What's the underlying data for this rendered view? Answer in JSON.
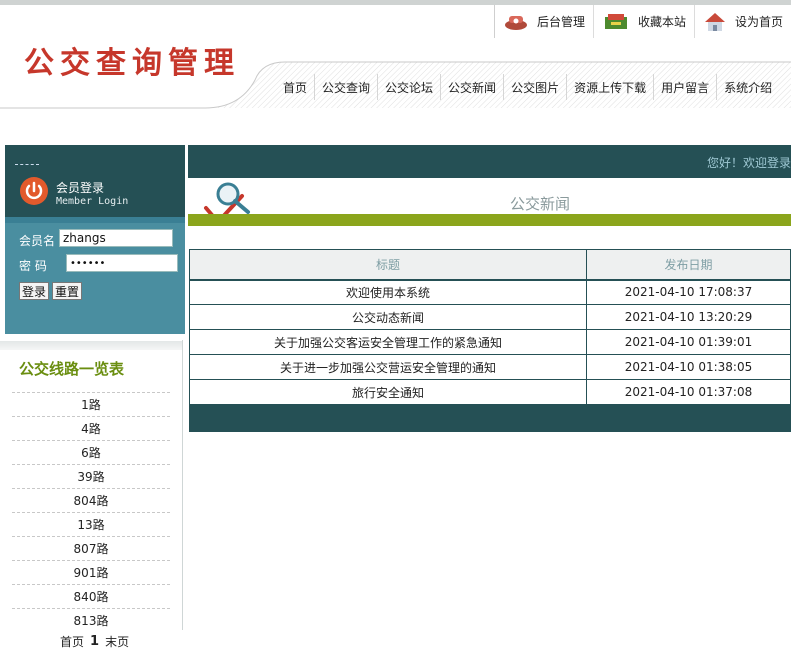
{
  "utility_links": [
    {
      "label": "后台管理",
      "icon": "phone-icon"
    },
    {
      "label": "收藏本站",
      "icon": "folder-icon"
    },
    {
      "label": "设为首页",
      "icon": "house-icon"
    }
  ],
  "logo_text": "公交查询管理",
  "nav": [
    "首页",
    "公交查询",
    "公交论坛",
    "公交新闻",
    "公交图片",
    "资源上传下载",
    "用户留言",
    "系统介绍"
  ],
  "login": {
    "title": "会员登录",
    "subtitle": "Member Login",
    "username_label": "会员名",
    "username_value": "zhangs",
    "password_label": "密 码",
    "password_value": "••••••",
    "login_button": "登录",
    "reset_button": "重置"
  },
  "routes": {
    "title": "公交线路一览表",
    "items": [
      "1路",
      "4路",
      "6路",
      "39路",
      "804路",
      "13路",
      "807路",
      "901路",
      "840路",
      "813路"
    ]
  },
  "pager": {
    "first": "首页",
    "current": "1",
    "last": "末页"
  },
  "welcome": "您好！欢迎登录",
  "section_title": "公交新闻",
  "news": {
    "headers": [
      "标题",
      "发布日期"
    ],
    "rows": [
      {
        "title": "欢迎使用本系统",
        "date": "2021-04-10 17:08:37"
      },
      {
        "title": "公交动态新闻",
        "date": "2021-04-10 13:20:29"
      },
      {
        "title": "关于加强公交客运安全管理工作的紧急通知",
        "date": "2021-04-10 01:39:01"
      },
      {
        "title": "关于进一步加强公交营运安全管理的通知",
        "date": "2021-04-10 01:38:05"
      },
      {
        "title": "旅行安全通知",
        "date": "2021-04-10 01:37:08"
      }
    ]
  },
  "colors": {
    "dark_teal": "#255055",
    "mid_teal": "#3a7f94",
    "olive": "#8ba51c",
    "logo_red": "#c6372b"
  }
}
